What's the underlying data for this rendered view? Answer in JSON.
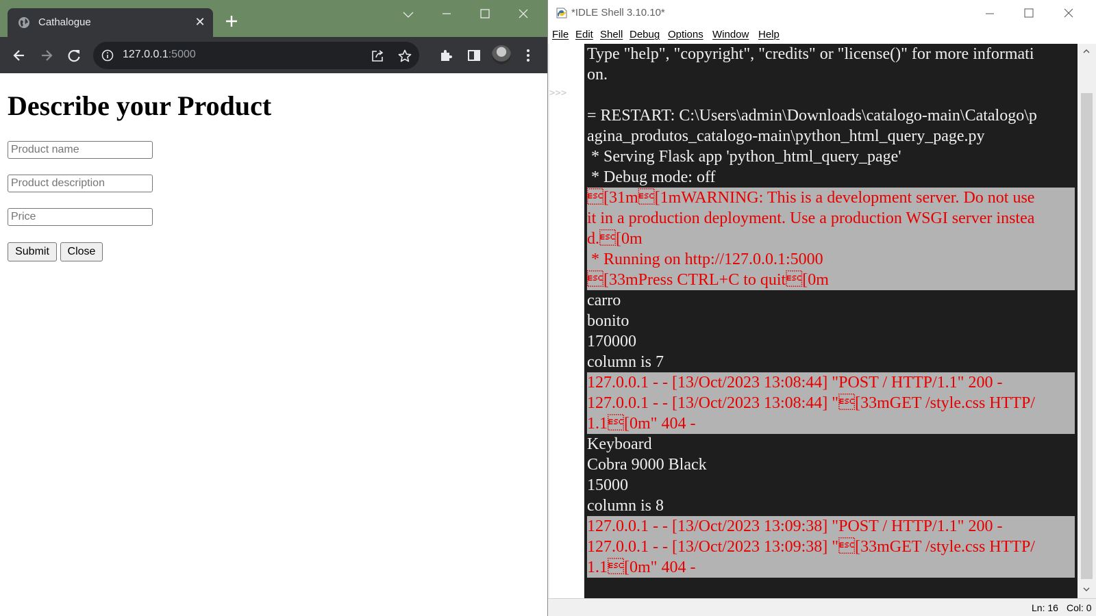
{
  "chrome": {
    "tab_title": "Cathalogue",
    "url_host": "127.0.0.1",
    "url_port": ":5000"
  },
  "page": {
    "heading": "Describe your Product",
    "product_name_placeholder": "Product name",
    "product_description_placeholder": "Product description",
    "price_placeholder": "Price",
    "submit_label": "Submit",
    "close_label": "Close"
  },
  "idle": {
    "title": "*IDLE Shell 3.10.10*",
    "menu": [
      "File",
      "Edit",
      "Shell",
      "Debug",
      "Options",
      "Window",
      "Help"
    ],
    "prompt": ">>>",
    "lines": [
      {
        "text": "Type \"help\", \"copyright\", \"credits\" or \"license()\" for more informati",
        "style": "normal"
      },
      {
        "text": "on.",
        "style": "normal"
      },
      {
        "text": "",
        "style": "normal"
      },
      {
        "text": "= RESTART: C:\\Users\\admin\\Downloads\\catalogo-main\\Catalogo\\p",
        "style": "normal"
      },
      {
        "text": "agina_produtos_catalogo-main\\python_html_query_page.py",
        "style": "normal"
      },
      {
        "text": " * Serving Flask app 'python_html_query_page'",
        "style": "normal"
      },
      {
        "text": " * Debug mode: off",
        "style": "normal"
      },
      {
        "text": "\u001b[31m\u001b[1mWARNING: This is a development server. Do not use",
        "style": "err"
      },
      {
        "text": "it in a production deployment. Use a production WSGI server instea",
        "style": "err"
      },
      {
        "text": "d.\u001b[0m",
        "style": "err"
      },
      {
        "text": " * Running on http://127.0.0.1:5000",
        "style": "err"
      },
      {
        "text": "\u001b[33mPress CTRL+C to quit\u001b[0m",
        "style": "err"
      },
      {
        "text": "carro",
        "style": "normal"
      },
      {
        "text": "bonito",
        "style": "normal"
      },
      {
        "text": "170000",
        "style": "normal"
      },
      {
        "text": "column is 7",
        "style": "normal"
      },
      {
        "text": "127.0.0.1 - - [13/Oct/2023 13:08:44] \"POST / HTTP/1.1\" 200 -",
        "style": "err"
      },
      {
        "text": "127.0.0.1 - - [13/Oct/2023 13:08:44] \"\u001b[33mGET /style.css HTTP/",
        "style": "err"
      },
      {
        "text": "1.1\u001b[0m\" 404 -",
        "style": "err"
      },
      {
        "text": "Keyboard",
        "style": "normal"
      },
      {
        "text": "Cobra 9000 Black",
        "style": "normal"
      },
      {
        "text": "15000",
        "style": "normal"
      },
      {
        "text": "column is 8",
        "style": "normal"
      },
      {
        "text": "127.0.0.1 - - [13/Oct/2023 13:09:38] \"POST / HTTP/1.1\" 200 -",
        "style": "err"
      },
      {
        "text": "127.0.0.1 - - [13/Oct/2023 13:09:38] \"\u001b[33mGET /style.css HTTP/",
        "style": "err"
      },
      {
        "text": "1.1\u001b[0m\" 404 -",
        "style": "err"
      }
    ],
    "status_ln": "Ln: 16",
    "status_col": "Col: 0"
  }
}
